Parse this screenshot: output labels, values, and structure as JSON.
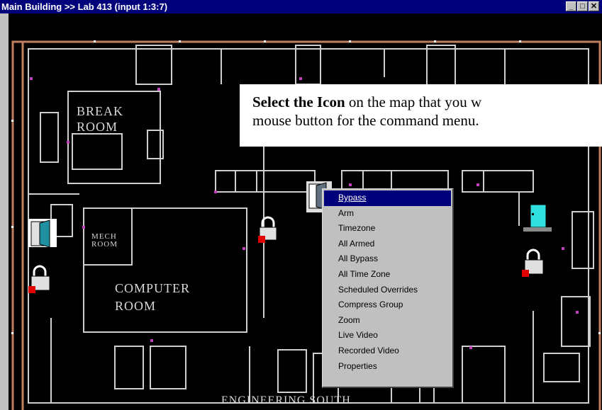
{
  "window": {
    "title": "Main Building  >>  Lab 413 (input 1:3:7)",
    "buttons": {
      "minimize": "_",
      "maximize": "□",
      "close": "✕"
    }
  },
  "map": {
    "rooms": {
      "break_room_line1": "BREAK",
      "break_room_line2": "ROOM",
      "mech_room_line1": "MECH",
      "mech_room_line2": "ROOM",
      "computer_room_line1": "COMPUTER",
      "computer_room_line2": "ROOM",
      "area": "ENGINEERING SOUTH"
    }
  },
  "callout": {
    "bold": "Select the Icon",
    "line1_rest": " on the map that you w",
    "line2": "mouse button for the command menu."
  },
  "context_menu": {
    "items": [
      {
        "label": "Bypass",
        "selected": true
      },
      {
        "label": "Arm",
        "selected": false
      },
      {
        "label": "Timezone",
        "selected": false
      },
      {
        "label": "All Armed",
        "selected": false
      },
      {
        "label": "All Bypass",
        "selected": false
      },
      {
        "label": "All Time Zone",
        "selected": false
      },
      {
        "label": "Scheduled Overrides",
        "selected": false
      },
      {
        "label": "Compress Group",
        "selected": false
      },
      {
        "label": "Zoom",
        "selected": false
      },
      {
        "label": "Live Video",
        "selected": false
      },
      {
        "label": "Recorded Video",
        "selected": false
      },
      {
        "label": "Properties",
        "selected": false
      }
    ]
  },
  "icons": [
    "door-open-icon",
    "padlock-icon",
    "door-cyan-icon"
  ],
  "colors": {
    "titlebar": "#00007b",
    "wall_outer": "#c08060",
    "wall_inner": "#d0d0d0",
    "menu_bg": "#c0c0c0",
    "highlight": "#00007b"
  }
}
